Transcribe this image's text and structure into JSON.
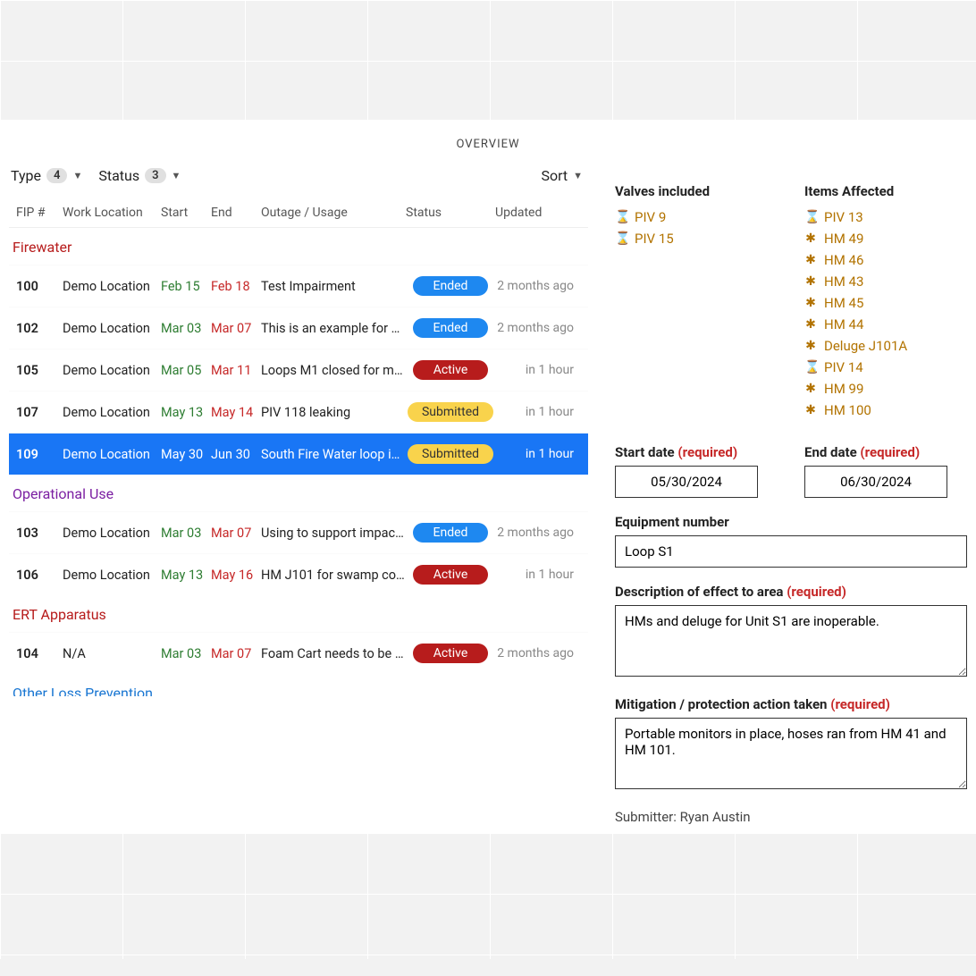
{
  "header": {
    "overview": "OVERVIEW"
  },
  "filters": {
    "type_label": "Type",
    "type_count": "4",
    "status_label": "Status",
    "status_count": "3",
    "sort_label": "Sort"
  },
  "columns": {
    "fip": "FIP #",
    "loc": "Work Location",
    "start": "Start",
    "end": "End",
    "outage": "Outage / Usage",
    "status": "Status",
    "updated": "Updated"
  },
  "groups": [
    {
      "name": "Firewater",
      "css": "group-firewater",
      "rows": [
        {
          "fip": "100",
          "loc": "Demo Location",
          "start": "Feb 15",
          "end": "Feb 18",
          "outage": "Test Impairment",
          "status": "Ended",
          "updated": "2 months ago",
          "selected": false
        },
        {
          "fip": "102",
          "loc": "Demo Location",
          "start": "Mar 03",
          "end": "Mar 07",
          "outage": "This is an example for s…",
          "status": "Ended",
          "updated": "2 months ago",
          "selected": false
        },
        {
          "fip": "105",
          "loc": "Demo Location",
          "start": "Mar 05",
          "end": "Mar 11",
          "outage": "Loops M1 closed for m…",
          "status": "Active",
          "updated": "in 1 hour",
          "selected": false
        },
        {
          "fip": "107",
          "loc": "Demo Location",
          "start": "May 13",
          "end": "May 14",
          "outage": "PIV 118 leaking",
          "status": "Submitted",
          "updated": "in 1 hour",
          "selected": false
        },
        {
          "fip": "109",
          "loc": "Demo Location",
          "start": "May 30",
          "end": "Jun 30",
          "outage": "South Fire Water loop is…",
          "status": "Submitted",
          "updated": "in 1 hour",
          "selected": true
        }
      ]
    },
    {
      "name": "Operational Use",
      "css": "group-operational",
      "rows": [
        {
          "fip": "103",
          "loc": "Demo Location",
          "start": "Mar 03",
          "end": "Mar 07",
          "outage": "Using to support impac…",
          "status": "Ended",
          "updated": "2 months ago",
          "selected": false
        },
        {
          "fip": "106",
          "loc": "Demo Location",
          "start": "May 13",
          "end": "May 16",
          "outage": "HM J101 for swamp co…",
          "status": "Active",
          "updated": "in 1 hour",
          "selected": false
        }
      ]
    },
    {
      "name": "ERT Apparatus",
      "css": "group-ert",
      "rows": [
        {
          "fip": "104",
          "loc": "N/A",
          "start": "Mar 03",
          "end": "Mar 07",
          "outage": "Foam Cart needs to be r…",
          "status": "Active",
          "updated": "2 months ago",
          "selected": false
        }
      ]
    },
    {
      "name": "Other Loss Prevention",
      "css": "group-other",
      "rows": []
    }
  ],
  "details": {
    "valves_title": "Valves included",
    "valves": [
      {
        "icon": "valve",
        "label": "PIV 9"
      },
      {
        "icon": "valve",
        "label": "PIV 15"
      }
    ],
    "items_title": "Items Affected",
    "items": [
      {
        "icon": "valve",
        "label": "PIV 13"
      },
      {
        "icon": "hm",
        "label": "HM 49"
      },
      {
        "icon": "hm",
        "label": "HM 46"
      },
      {
        "icon": "hm",
        "label": "HM 43"
      },
      {
        "icon": "hm",
        "label": "HM 45"
      },
      {
        "icon": "hm",
        "label": "HM 44"
      },
      {
        "icon": "hm",
        "label": "Deluge J101A"
      },
      {
        "icon": "valve",
        "label": "PIV 14"
      },
      {
        "icon": "hm",
        "label": "HM 99"
      },
      {
        "icon": "hm",
        "label": "HM 100"
      }
    ],
    "start_date_label": "Start date",
    "start_date": "05/30/2024",
    "end_date_label": "End date",
    "end_date": "06/30/2024",
    "equipment_label": "Equipment number",
    "equipment": "Loop S1",
    "desc_label": "Description of effect to area",
    "desc": "HMs and deluge for Unit S1 are inoperable.",
    "mitigation_label": "Mitigation / protection action taken",
    "mitigation": "Portable monitors in place, hoses ran from HM 41 and HM 101.",
    "required": "(required)",
    "submitter_label": "Submitter:",
    "submitter": "Ryan Austin"
  }
}
